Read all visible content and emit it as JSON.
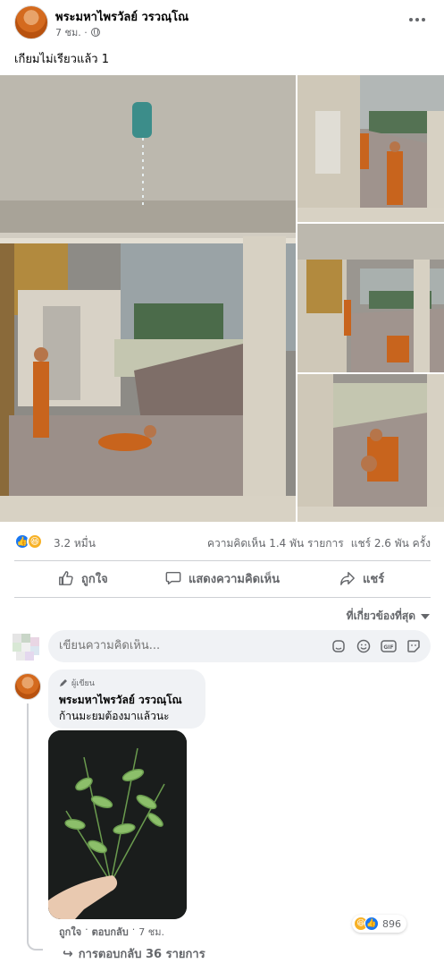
{
  "post": {
    "author": "พระมหาไพรวัลย์ วรวณฺโณ",
    "time": "7 ชม. ·",
    "text": "เกียมไม่เรียวแล้ว 1"
  },
  "reactions": {
    "count": "3.2 หมื่น",
    "comments": "ความคิดเห็น 1.4 พัน รายการ",
    "shares": "แชร์ 2.6 พัน ครั้ง"
  },
  "actions": {
    "like": "ถูกใจ",
    "comment": "แสดงความคิดเห็น",
    "share": "แชร์"
  },
  "sort_label": "ที่เกี่ยวข้องที่สุด",
  "comment_box": {
    "placeholder": "เขียนความคิดเห็น..."
  },
  "comment": {
    "badge": "ผู้เขียน",
    "author": "พระมหาไพรวัลย์ วรวณฺโณ",
    "text": "ก้านมะยมต้องมาแล้วนะ",
    "like_label": "ถูกใจ",
    "reply_label": "ตอบกลับ",
    "time": "7 ชม.",
    "reaction_count": "896",
    "replies": "การตอบกลับ 36 รายการ"
  },
  "colors": {
    "accent": "#1877f2",
    "secondary_text": "#65676b",
    "robe": "#c8641d"
  },
  "icons": [
    "like-outline-icon",
    "comment-outline-icon",
    "share-arrow-icon",
    "globe-icon",
    "more-dots-icon",
    "sticker-icon",
    "emoji-icon",
    "gif-icon",
    "avatar-sticker-icon",
    "pencil-icon"
  ]
}
